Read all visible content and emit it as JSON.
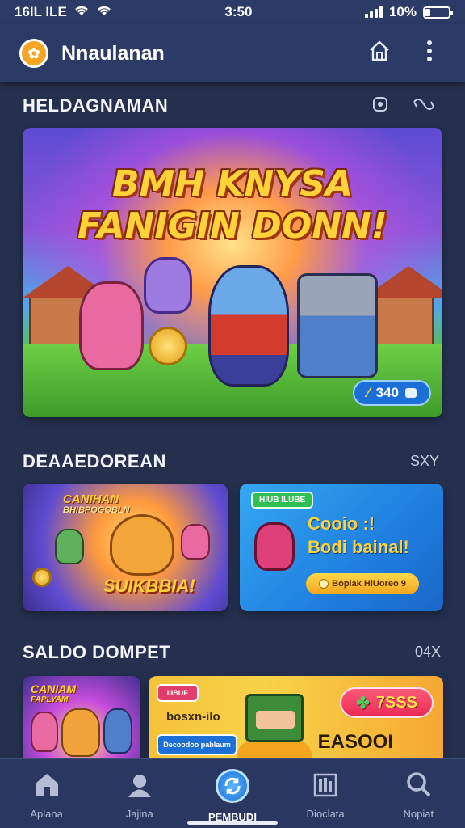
{
  "status_bar": {
    "left": "16IL ILE",
    "time": "3:50",
    "battery": "10%"
  },
  "app_bar": {
    "title": "Nnaulanan"
  },
  "hero_section": {
    "title": "HELDAGNAMAN",
    "banner": {
      "line1": "BMH KNYSA",
      "line2": "FANIGIN DONN!",
      "badge_value": "340"
    }
  },
  "promo_section": {
    "title": "DEAAEDOREAN",
    "aux": "SXY",
    "left_card": {
      "top_line1": "CANIHAN",
      "top_line2": "BHIBPOGOBLN",
      "bottom": "SUIKBBIA!"
    },
    "right_card": {
      "tag": "HIUB ILUBE",
      "line1": "Cooio :!",
      "line2": "Bodi bainal!",
      "button": "Boplak HiUoreo 9"
    }
  },
  "wallet_section": {
    "title": "SALDO DOMPET",
    "aux": "04X",
    "small_card": {
      "line1": "CANIAM",
      "line2": "FAPLYAM"
    },
    "big_card": {
      "pill": "IIIBUE",
      "text": "bosxn-ilo",
      "button": "Decoodoo pablaum",
      "amount": "7SSS",
      "label": "EASOOI"
    }
  },
  "bottom_nav": {
    "items": [
      {
        "label": "Aplana",
        "icon": "home-icon"
      },
      {
        "label": "Jajina",
        "icon": "user-icon"
      },
      {
        "label": "PEMBUDI",
        "icon": "refresh-icon"
      },
      {
        "label": "Dioclata",
        "icon": "chart-icon"
      },
      {
        "label": "Nopiat",
        "icon": "search-icon"
      }
    ],
    "active_index": 2
  }
}
